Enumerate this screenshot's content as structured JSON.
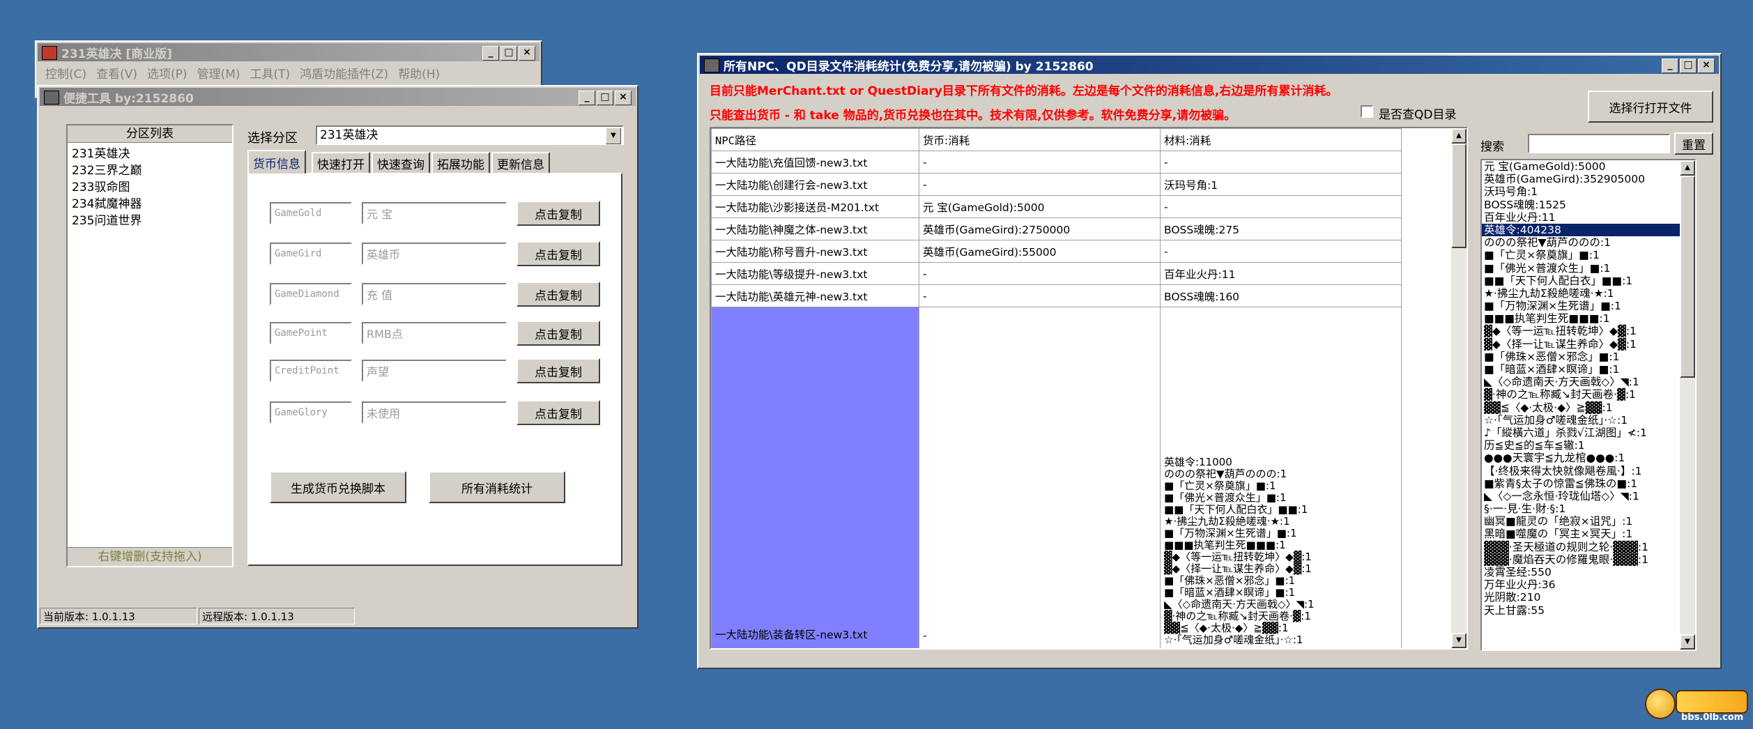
{
  "main_window": {
    "title": "231英雄决 [商业版]",
    "menu": [
      "控制(C)",
      "查看(V)",
      "选项(P)",
      "管理(M)",
      "工具(T)",
      "鸿盾功能插件(Z)",
      "帮助(H)"
    ]
  },
  "tool_window": {
    "title": "便捷工具  by:2152860",
    "partition_header": "分区列表",
    "partitions": [
      "231英雄决",
      "232三界之巅",
      "233驭命图",
      "234弑魔神器",
      "235问道世界"
    ],
    "list_footer": "右键增删(支持拖入)",
    "select_label": "选择分区",
    "select_value": "231英雄决",
    "tabs": [
      "货币信息",
      "快速打开",
      "快速查询",
      "拓展功能",
      "更新信息"
    ],
    "currencies": [
      {
        "code": "GameGold",
        "name": "元  宝",
        "button": "点击复制"
      },
      {
        "code": "GameGird",
        "name": "英雄币",
        "button": "点击复制"
      },
      {
        "code": "GameDiamond",
        "name": "充  值",
        "button": "点击复制"
      },
      {
        "code": "GamePoint",
        "name": "RMB点",
        "button": "点击复制"
      },
      {
        "code": "CreditPoint",
        "name": "声望",
        "button": "点击复制"
      },
      {
        "code": "GameGlory",
        "name": "未使用",
        "button": "点击复制"
      }
    ],
    "btn_generate": "生成货币兑换脚本",
    "btn_stats": "所有消耗统计",
    "status_current": "当前版本: 1.0.1.13",
    "status_remote": "远程版本: 1.0.1.13"
  },
  "stats_window": {
    "title": "所有NPC、QD目录文件消耗统计(免费分享,请勿被骗)    by 2152860",
    "notice1": "目前只能MerChant.txt or QuestDiary目录下所有文件的消耗。左边是每个文件的消耗信息,右边是所有累计消耗。",
    "notice2": "只能查出货币 - 和 take 物品的,货币兑换也在其中。技术有限,仅供参考。软件免费分享,请勿被骗。",
    "qd_checkbox": "是否查QD目录",
    "btn_open_file": "选择行打开文件",
    "search_label": "搜索",
    "btn_reset": "重置",
    "columns": [
      "NPC路径",
      "货币:消耗",
      "材料:消耗"
    ],
    "rows": [
      {
        "path": "一大陆功能\\充值回馈-new3.txt",
        "currency": "-",
        "material": "-"
      },
      {
        "path": "一大陆功能\\创建行会-new3.txt",
        "currency": "-",
        "material": "沃玛号角:1"
      },
      {
        "path": "一大陆功能\\沙影接送员-M201.txt",
        "currency": "元  宝(GameGold):5000",
        "material": "-"
      },
      {
        "path": "一大陆功能\\神魔之体-new3.txt",
        "currency": "英雄币(GameGird):2750000",
        "material": "BOSS魂魄:275"
      },
      {
        "path": "一大陆功能\\称号晋升-new3.txt",
        "currency": "英雄币(GameGird):55000",
        "material": "-"
      },
      {
        "path": "一大陆功能\\等级提升-new3.txt",
        "currency": "-",
        "material": "百年业火丹:11"
      },
      {
        "path": "一大陆功能\\英雄元神-new3.txt",
        "currency": "-",
        "material": "BOSS魂魄:160"
      }
    ],
    "big_row": {
      "path": "一大陆功能\\装备转区-new3.txt",
      "currency": "-",
      "material_lines": [
        "英雄令:11000",
        "ののの祭祀▼葫芦ののの:1",
        "■「亡灵×祭奠旗」■:1",
        "■「佛光×普渡众生」■:1",
        "■■「天下何人配白衣」■■:1",
        "★·拂尘九劫Σ殺絶嗟魂·★:1",
        "■「万物深渊×生死谱」■:1",
        "■■■执笔判生死■■■:1",
        "▓◆〈等一运℡扭转乾坤〉◆▓:1",
        "▓◆〈择一让℡谋生养命〉◆▓:1",
        "■「佛珠×恶僧×邪念」■:1",
        "■「暗蓝×酒肆×瞑谛」■:1",
        "◣〈◇命遗南天·方天画戟◇〉◥:1",
        "▓·神の之℡称臧↘封天画卷·▓:1",
        "▓▓≦〈◆·太极·◆〉≧▓▓:1",
        "☆·「气运加身♂嗟魂金纸」·☆:1"
      ]
    },
    "totals": [
      "元  宝(GameGold):5000",
      "英雄币(GameGird):352905000",
      "沃玛号角:1",
      "BOSS魂魄:1525",
      "百年业火丹:11",
      "英雄令:404238",
      "ののの祭祀▼葫芦ののの:1",
      "■「亡灵×祭奠旗」■:1",
      "■「佛光×普渡众生」■:1",
      "■■「天下何人配白衣」■■:1",
      "★·拂尘九劫Σ殺絶嗟魂·★:1",
      "■「万物深渊×生死谱」■:1",
      "■■■执笔判生死■■■:1",
      "▓◆〈等一运℡扭转乾坤〉◆▓:1",
      "▓◆〈择一让℡谋生养命〉◆▓:1",
      "■「佛珠×恶僧×邪念」■:1",
      "■「暗蓝×酒肆×瞑谛」■:1",
      "◣〈◇命遗南天·方天画戟◇〉◥:1",
      "▓·神の之℡称臧↘封天画卷·▓:1",
      "▓▓≦〈◆·太极·◆〉≧▓▓:1",
      "☆·「气运加身♂嗟魂金纸」·☆:1",
      "♪「縱橫六道」杀戮√江湖图」≮:1",
      "历≦史≦的≦车≦辙:1",
      "●●●天寰宇≦九龙棺●●●:1",
      "【·终极来得太快就像飓卷風·】:1",
      "■紫青§太子の惊雷≦佛珠の■:1",
      "◣〈◇一念永恒·玲珑仙塔◇〉◥:1",
      "§·一·見·生·財·§:1",
      "幽冥■龍灵の「绝寂×诅咒」:1",
      "黑暗■噬魔の「冥主×冥天」:1",
      "▓▓▓·圣天極道の规则之轮·▓▓▓:1",
      "▓▓▓·魔焰吞天の修羅鬼眼·▓▓▓:1",
      "凌霄圣经:550",
      "万年业火丹:36",
      "光阴散:210",
      "天上甘露:55"
    ],
    "selected_total_index": 5
  },
  "watermark": {
    "text": "bbs.0lb.com"
  }
}
